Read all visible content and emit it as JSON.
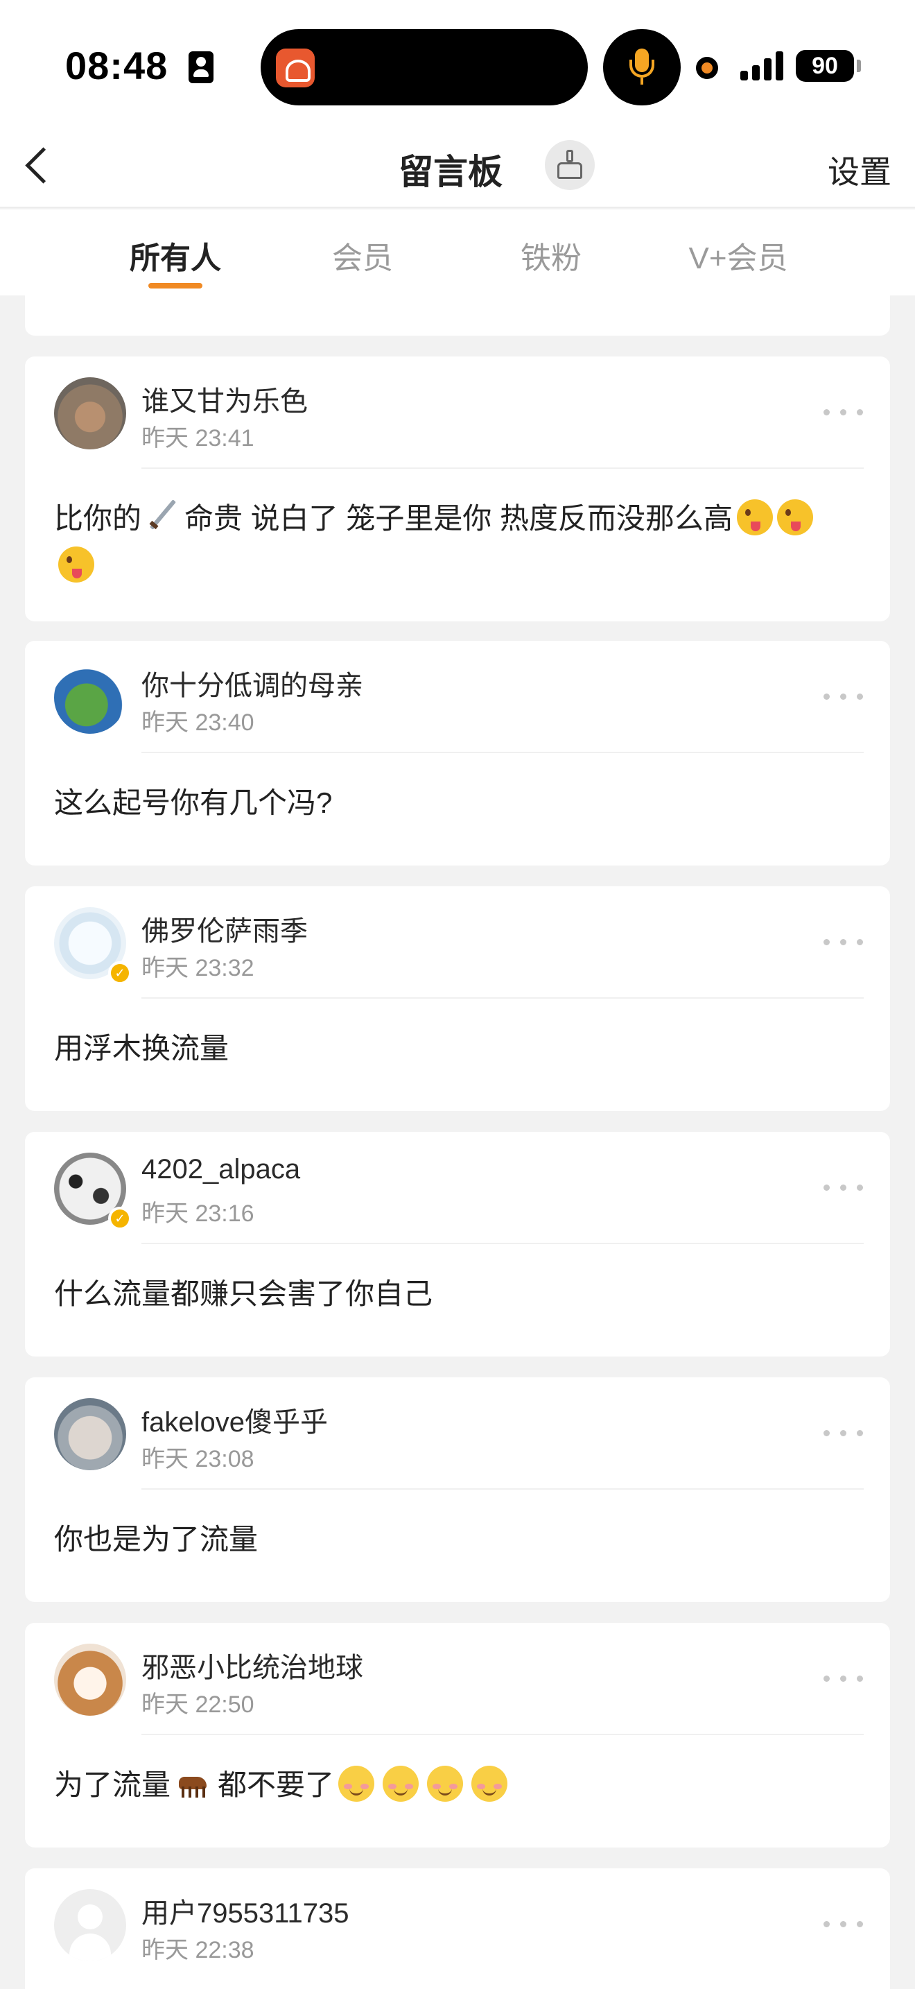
{
  "status_bar": {
    "time": "08:48",
    "battery": "90",
    "icons": [
      "id-card-icon",
      "dynamic-island-app-icon",
      "microphone-icon",
      "recording-dot-icon",
      "signal-icon",
      "battery-icon"
    ]
  },
  "nav": {
    "title": "留言板",
    "settings_label": "设置",
    "icons": [
      "back-chevron-icon",
      "clean-brush-icon"
    ]
  },
  "tabs": [
    {
      "label": "所有人",
      "active": true
    },
    {
      "label": "会员",
      "active": false
    },
    {
      "label": "铁粉",
      "active": false
    },
    {
      "label": "V+会员",
      "active": false
    }
  ],
  "accent_color": "#f08a24",
  "comments": [
    {
      "username": "谁又甘为乐色",
      "time": "昨天 23:41",
      "verified": false,
      "text_a": "比你的",
      "text_b": "命贵 说白了 笼子里是你 热度反而没那么高"
    },
    {
      "username": "你十分低调的母亲",
      "time": "昨天 23:40",
      "verified": false,
      "text": "这么起号你有几个冯?"
    },
    {
      "username": "佛罗伦萨雨季",
      "time": "昨天 23:32",
      "verified": true,
      "text": "用浮木换流量"
    },
    {
      "username": "4202_alpaca",
      "time": "昨天 23:16",
      "verified": true,
      "text": "什么流量都赚只会害了你自己"
    },
    {
      "username": "fakelove傻乎乎",
      "time": "昨天 23:08",
      "verified": false,
      "text": "你也是为了流量"
    },
    {
      "username": "邪恶小比统治地球",
      "time": "昨天 22:50",
      "verified": false,
      "text_a": "为了流量",
      "text_b": "都不要了"
    },
    {
      "username": "用户7955311735",
      "time": "昨天 22:38",
      "verified": false
    }
  ]
}
